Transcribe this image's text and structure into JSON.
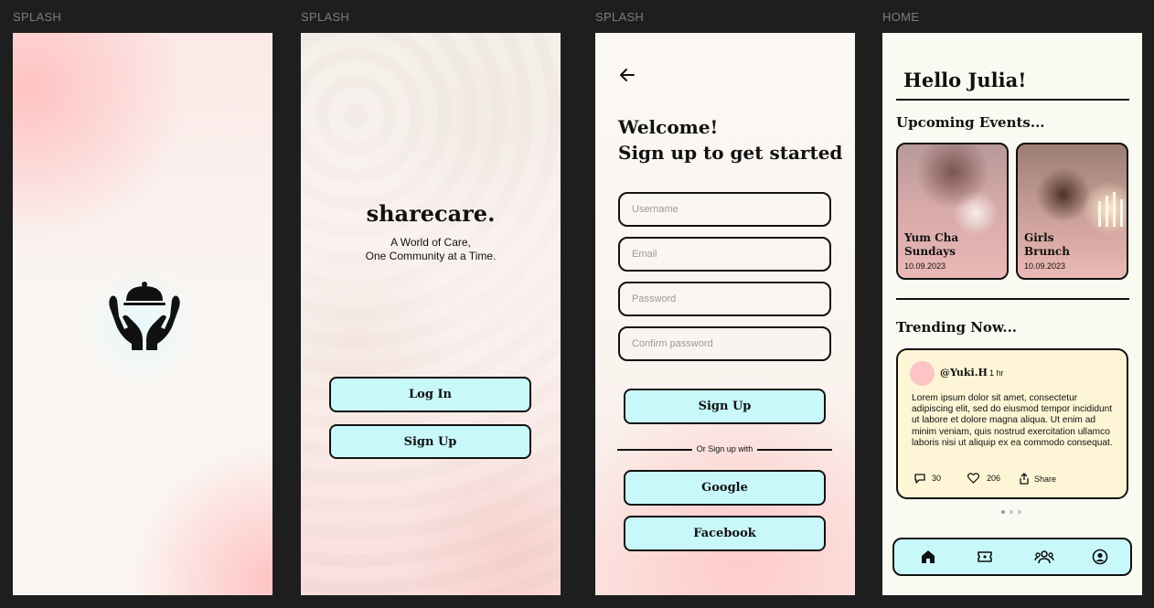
{
  "frames": {
    "f1": {
      "label": "SPLASH"
    },
    "f2": {
      "label": "SPLASH",
      "brand": "sharecare.",
      "tagline_line1": "A World of Care,",
      "tagline_line2": "One Community at a Time.",
      "login_label": "Log In",
      "signup_label": "Sign Up"
    },
    "f3": {
      "label": "SPLASH",
      "title_line1": "Welcome!",
      "title_line2": "Sign up to get started",
      "fields": {
        "username": {
          "placeholder": "Username",
          "value": ""
        },
        "email": {
          "placeholder": "Email",
          "value": ""
        },
        "password": {
          "placeholder": "Password",
          "value": ""
        },
        "confirm": {
          "placeholder": "Confirm password",
          "value": ""
        }
      },
      "signup_label": "Sign Up",
      "divider_text": "Or Sign up with",
      "google_label": "Google",
      "facebook_label": "Facebook"
    },
    "f4": {
      "label": "HOME",
      "greeting": "Hello Julia!",
      "upcoming_title": "Upcoming Events...",
      "events": [
        {
          "title_line1": "Yum Cha",
          "title_line2": "Sundays",
          "date": "10.09.2023"
        },
        {
          "title_line1": "Girls",
          "title_line2": "Brunch",
          "date": "10.09.2023"
        }
      ],
      "trending_title": "Trending Now...",
      "post": {
        "user": "@Yuki.H",
        "time": "1 hr",
        "body": "Lorem ipsum dolor sit amet, consectetur adipiscing elit, sed do eiusmod tempor incididunt ut labore et dolore magna aliqua. Ut enim ad minim veniam, quis nostrud exercitation ullamco laboris nisi ut aliquip ex ea commodo consequat.",
        "comments": "30",
        "likes": "206",
        "share": "Share"
      },
      "nav_icons": [
        "home-icon",
        "ticket-icon",
        "community-icon",
        "profile-icon"
      ]
    }
  },
  "colors": {
    "background": "#1e1e1e",
    "accent": "#c9f8fb",
    "post_bg": "#fdf5d5",
    "avatar": "#fcc4c4",
    "ink": "#111111"
  }
}
